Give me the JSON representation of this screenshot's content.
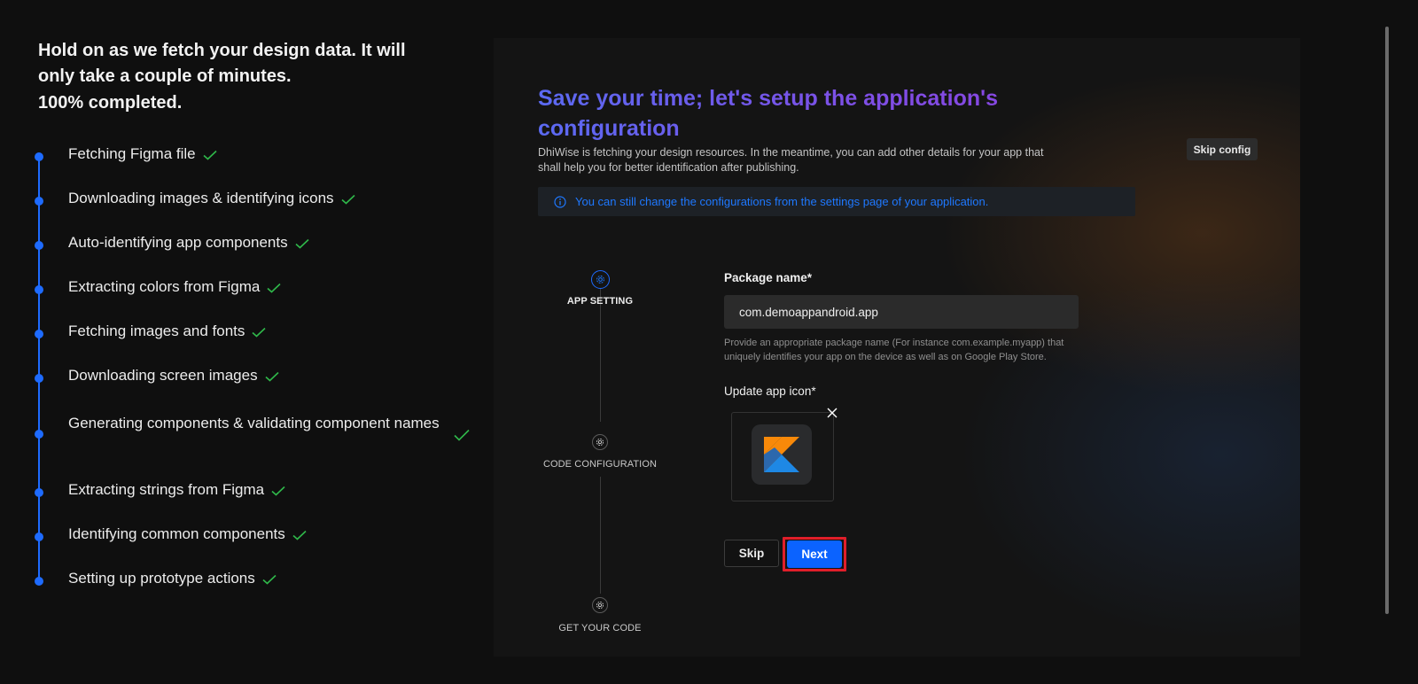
{
  "left": {
    "headline": "Hold on as we fetch your design data. It will only take a couple of minutes.",
    "progress_text": "100% completed.",
    "steps": [
      {
        "label": "Fetching Figma file"
      },
      {
        "label": "Downloading images & identifying icons"
      },
      {
        "label": "Auto-identifying app components"
      },
      {
        "label": "Extracting colors from Figma"
      },
      {
        "label": "Fetching images and fonts"
      },
      {
        "label": "Downloading screen images"
      },
      {
        "label": "Generating components & validating component names"
      },
      {
        "label": "Extracting strings from Figma"
      },
      {
        "label": "Identifying common components"
      },
      {
        "label": "Setting up prototype actions"
      }
    ]
  },
  "panel": {
    "title": "Save your time; let's setup the application's configuration",
    "description": "DhiWise is fetching your design resources. In the meantime, you can add other details for your app that shall help you for better identification after publishing.",
    "skip_config_label": "Skip config",
    "info_text": "You can still change the configurations from the settings page of your application.",
    "stepper": [
      {
        "label": "APP SETTING",
        "active": true
      },
      {
        "label": "CODE CONFIGURATION",
        "active": false
      },
      {
        "label": "GET YOUR CODE",
        "active": false
      }
    ],
    "form": {
      "package_label": "Package name*",
      "package_value": "com.demoappandroid.app",
      "package_hint": "Provide an appropriate package name (For instance com.example.myapp) that uniquely identifies your app on the device as well as on Google Play Store.",
      "icon_label": "Update app icon*",
      "skip_label": "Skip",
      "next_label": "Next"
    }
  },
  "colors": {
    "accent": "#1e6bff",
    "check": "#2fb84a",
    "next_button": "#0b63ff",
    "highlight": "#e01e2a"
  },
  "icons": [
    "check-icon",
    "info-icon",
    "gear-icon",
    "close-icon",
    "kotlin-logo"
  ]
}
